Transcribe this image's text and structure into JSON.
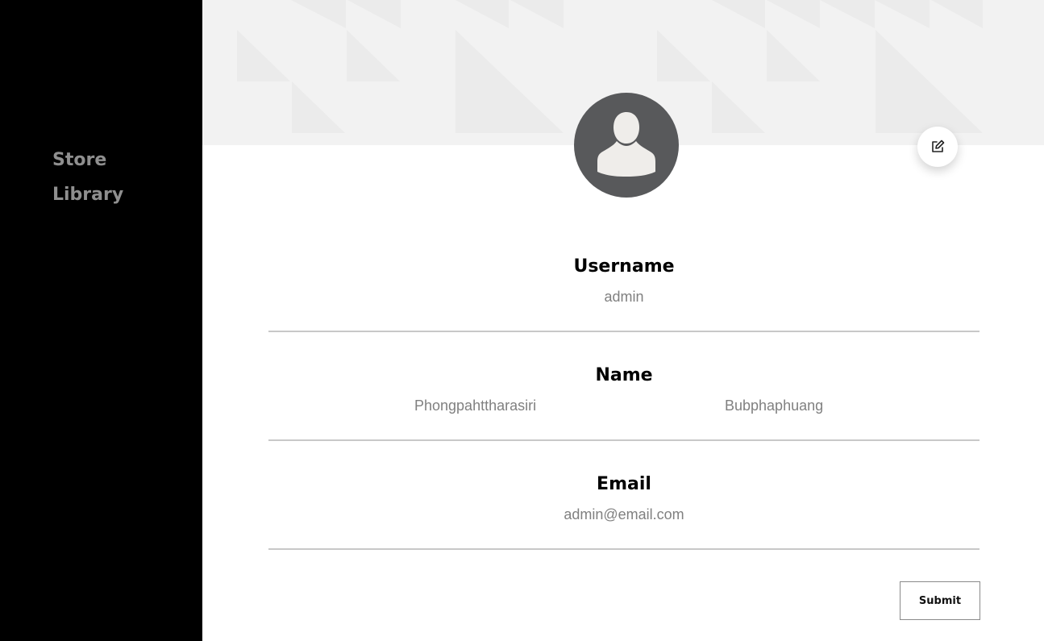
{
  "sidebar": {
    "items": [
      {
        "label": "Store"
      },
      {
        "label": "Library"
      }
    ]
  },
  "profile": {
    "avatar_icon": "user-silhouette-icon",
    "edit_icon": "edit-icon",
    "fields": {
      "username": {
        "label": "Username",
        "value": "admin"
      },
      "name": {
        "label": "Name",
        "first": "Phongpahttharasiri",
        "last": "Bubphaphuang"
      },
      "email": {
        "label": "Email",
        "value": "admin@email.com"
      }
    },
    "submit_label": "Submit"
  },
  "colors": {
    "sidebar_bg": "#000000",
    "sidebar_text": "#8f8f8f",
    "banner_bg": "#f2f2f2",
    "avatar_bg": "#58595b",
    "divider": "#c8c8c8",
    "value_text": "#808080"
  }
}
